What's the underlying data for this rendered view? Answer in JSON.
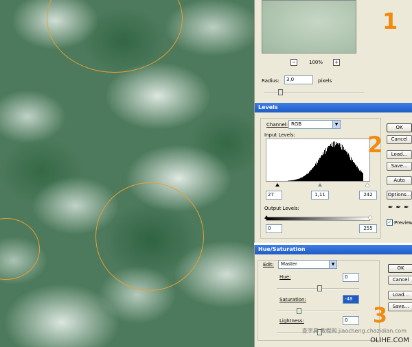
{
  "gaussian_blur": {
    "zoom": "100%",
    "zoom_out": "−",
    "zoom_in": "+",
    "radius_label": "Radius:",
    "radius_value": "3,0",
    "radius_unit": "pixels",
    "step_number": "1"
  },
  "levels": {
    "title": "Levels",
    "channel_label": "Channel:",
    "channel_value": "RGB",
    "input_levels_label": "Input Levels:",
    "input_black": "27",
    "input_gamma": "1,11",
    "input_white": "242",
    "output_levels_label": "Output Levels:",
    "output_black": "0",
    "output_white": "255",
    "buttons": {
      "ok": "OK",
      "cancel": "Cancel",
      "load": "Load...",
      "save": "Save...",
      "auto": "Auto",
      "options": "Options..."
    },
    "preview_label": "Preview",
    "preview_checked": true,
    "step_number": "2"
  },
  "hue_saturation": {
    "title": "Hue/Saturation",
    "edit_label": "Edit:",
    "edit_value": "Master",
    "hue_label": "Hue:",
    "hue_value": "0",
    "saturation_label": "Saturation:",
    "saturation_value": "-48",
    "lightness_label": "Lightness:",
    "lightness_value": "0",
    "buttons": {
      "ok": "OK",
      "cancel": "Cancel",
      "load": "Load...",
      "save": "Save..."
    },
    "step_number": "3"
  },
  "watermark": {
    "site": "OLIHE.COM",
    "cn": "查字典 教程网",
    "sub": "jiaocheng.chazidian.com"
  },
  "colors": {
    "accent_orange": "#f08a10",
    "circle_orange": "#e8a030",
    "titlebar_blue": "#1f5bc4"
  }
}
